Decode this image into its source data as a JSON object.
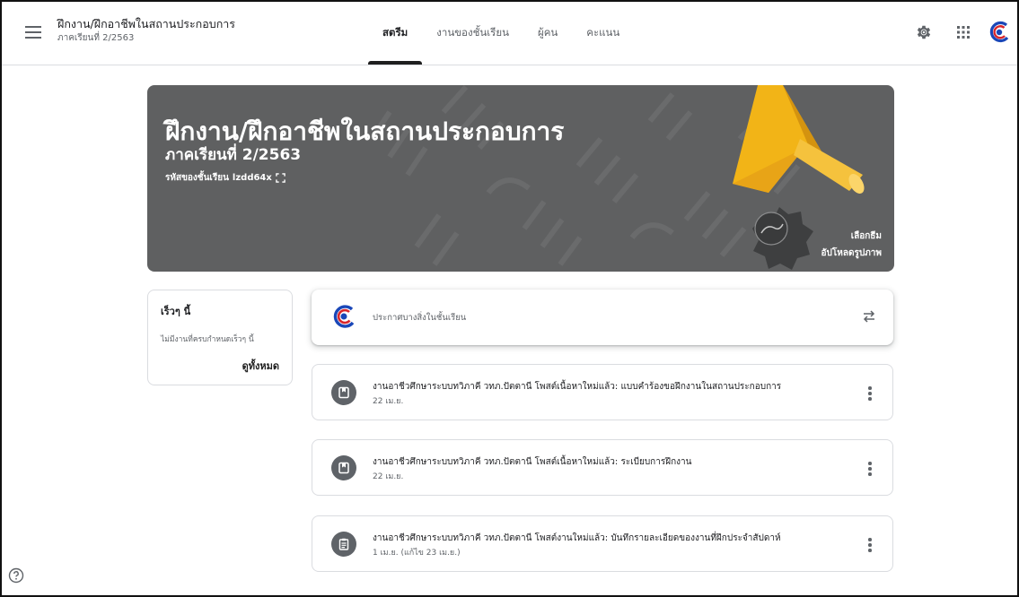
{
  "header": {
    "class_name": "ฝึกงาน/ฝึกอาชีพในสถานประกอบการ",
    "class_section": "ภาคเรียนที่ 2/2563",
    "tabs": [
      {
        "label": "สตรีม",
        "active": true
      },
      {
        "label": "งานของชั้นเรียน",
        "active": false
      },
      {
        "label": "ผู้คน",
        "active": false
      },
      {
        "label": "คะแนน",
        "active": false
      }
    ],
    "icons": [
      "menu-icon",
      "gear-icon",
      "apps-grid-icon",
      "school-logo"
    ]
  },
  "banner": {
    "title": "ฝึกงาน/ฝึกอาชีพในสถานประกอบการ",
    "subtitle": "ภาคเรียนที่ 2/2563",
    "code_label": "รหัสของชั้นเรียน",
    "code_value": "lzdd64x",
    "select_theme": "เลือกธีม",
    "upload_photo": "อัปโหลดรูปภาพ",
    "color": "#5f6061",
    "accent": "#f2b417"
  },
  "upcoming": {
    "title": "เร็วๆ นี้",
    "text": "ไม่มีงานที่ครบกำหนดเร็วๆ นี้",
    "view_all": "ดูทั้งหมด"
  },
  "announce": {
    "placeholder": "ประกาศบางสิ่งในชั้นเรียน"
  },
  "posts": [
    {
      "icon": "material-icon",
      "title": "งานอาชีวศึกษาระบบทวิภาคี วทภ.ปัตตานี โพสต์เนื้อหาใหม่แล้ว: แบบคำร้องขอฝึกงานในสถานประกอบการ",
      "date": "22 เม.ย."
    },
    {
      "icon": "material-icon",
      "title": "งานอาชีวศึกษาระบบทวิภาคี วทภ.ปัตตานี โพสต์เนื้อหาใหม่แล้ว: ระเบียบการฝึกงาน",
      "date": "22 เม.ย."
    },
    {
      "icon": "assignment-icon",
      "title": "งานอาชีวศึกษาระบบทวิภาคี วทภ.ปัตตานี โพสต์งานใหม่แล้ว: บันทึกรายละเอียดของงานที่ฝึกประจำสัปดาห์",
      "date": "1 เม.ย. (แก้ไข 23 เม.ย.)"
    }
  ]
}
